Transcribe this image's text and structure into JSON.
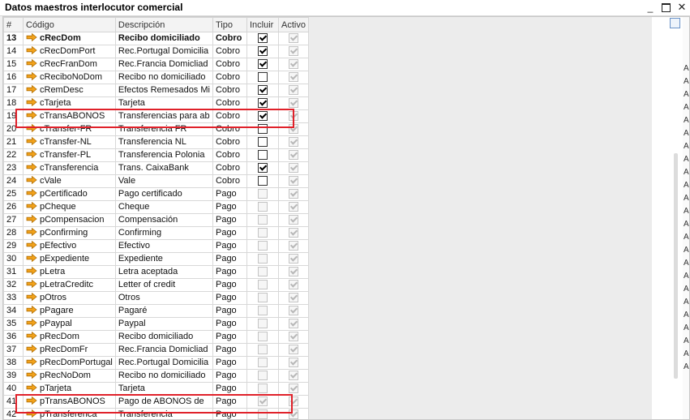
{
  "window": {
    "title": "Datos maestros interlocutor comercial"
  },
  "columns": {
    "num": "#",
    "code": "Código",
    "desc": "Descripción",
    "type": "Tipo",
    "include": "Incluir",
    "active": "Activo"
  },
  "rows": [
    {
      "num": "13",
      "code": "cRecDom",
      "desc": "Recibo domiciliado",
      "type": "Cobro",
      "include": true,
      "include_enabled": true,
      "active": true,
      "bold": true
    },
    {
      "num": "14",
      "code": "cRecDomPort",
      "desc": "Rec.Portugal Domicilia",
      "type": "Cobro",
      "include": true,
      "include_enabled": true,
      "active": true
    },
    {
      "num": "15",
      "code": "cRecFranDom",
      "desc": "Rec.Francia Domicliad",
      "type": "Cobro",
      "include": true,
      "include_enabled": true,
      "active": true
    },
    {
      "num": "16",
      "code": "cReciboNoDom",
      "desc": "Recibo no domiciliado",
      "type": "Cobro",
      "include": false,
      "include_enabled": true,
      "active": true
    },
    {
      "num": "17",
      "code": "cRemDesc",
      "desc": "Efectos Remesados Mi",
      "type": "Cobro",
      "include": true,
      "include_enabled": true,
      "active": true
    },
    {
      "num": "18",
      "code": "cTarjeta",
      "desc": "Tarjeta",
      "type": "Cobro",
      "include": true,
      "include_enabled": true,
      "active": true
    },
    {
      "num": "19",
      "code": "cTransABONOS",
      "desc": "Transferencias para ab",
      "type": "Cobro",
      "include": true,
      "include_enabled": true,
      "active": true
    },
    {
      "num": "20",
      "code": "cTransfer-FR",
      "desc": "Transferencia FR",
      "type": "Cobro",
      "include": false,
      "include_enabled": true,
      "active": true
    },
    {
      "num": "21",
      "code": "cTransfer-NL",
      "desc": "Transferencia NL",
      "type": "Cobro",
      "include": false,
      "include_enabled": true,
      "active": true
    },
    {
      "num": "22",
      "code": "cTransfer-PL",
      "desc": "Transferencia Polonia",
      "type": "Cobro",
      "include": false,
      "include_enabled": true,
      "active": true
    },
    {
      "num": "23",
      "code": "cTransferencia",
      "desc": "Trans. CaixaBank",
      "type": "Cobro",
      "include": true,
      "include_enabled": true,
      "active": true
    },
    {
      "num": "24",
      "code": "cVale",
      "desc": "Vale",
      "type": "Cobro",
      "include": false,
      "include_enabled": true,
      "active": true
    },
    {
      "num": "25",
      "code": "pCertificado",
      "desc": "Pago certificado",
      "type": "Pago",
      "include": false,
      "include_enabled": false,
      "active": true
    },
    {
      "num": "26",
      "code": "pCheque",
      "desc": "Cheque",
      "type": "Pago",
      "include": false,
      "include_enabled": false,
      "active": true
    },
    {
      "num": "27",
      "code": "pCompensacion",
      "desc": "Compensación",
      "type": "Pago",
      "include": false,
      "include_enabled": false,
      "active": true
    },
    {
      "num": "28",
      "code": "pConfirming",
      "desc": "Confirming",
      "type": "Pago",
      "include": false,
      "include_enabled": false,
      "active": true
    },
    {
      "num": "29",
      "code": "pEfectivo",
      "desc": "Efectivo",
      "type": "Pago",
      "include": false,
      "include_enabled": false,
      "active": true
    },
    {
      "num": "30",
      "code": "pExpediente",
      "desc": "Expediente",
      "type": "Pago",
      "include": false,
      "include_enabled": false,
      "active": true
    },
    {
      "num": "31",
      "code": "pLetra",
      "desc": "Letra aceptada",
      "type": "Pago",
      "include": false,
      "include_enabled": false,
      "active": true
    },
    {
      "num": "32",
      "code": "pLetraCreditc",
      "desc": "Letter of credit",
      "type": "Pago",
      "include": false,
      "include_enabled": false,
      "active": true
    },
    {
      "num": "33",
      "code": "pOtros",
      "desc": "Otros",
      "type": "Pago",
      "include": false,
      "include_enabled": false,
      "active": true
    },
    {
      "num": "34",
      "code": "pPagare",
      "desc": "Pagaré",
      "type": "Pago",
      "include": false,
      "include_enabled": false,
      "active": true
    },
    {
      "num": "35",
      "code": "pPaypal",
      "desc": "Paypal",
      "type": "Pago",
      "include": false,
      "include_enabled": false,
      "active": true
    },
    {
      "num": "36",
      "code": "pRecDom",
      "desc": "Recibo domiciliado",
      "type": "Pago",
      "include": false,
      "include_enabled": false,
      "active": true
    },
    {
      "num": "37",
      "code": "pRecDomFr",
      "desc": "Rec.Francia Domicliad",
      "type": "Pago",
      "include": false,
      "include_enabled": false,
      "active": true
    },
    {
      "num": "38",
      "code": "pRecDomPortugal",
      "desc": "Rec.Portugal Domicilia",
      "type": "Pago",
      "include": false,
      "include_enabled": false,
      "active": true
    },
    {
      "num": "39",
      "code": "pRecNoDom",
      "desc": "Recibo no domiciliado",
      "type": "Pago",
      "include": false,
      "include_enabled": false,
      "active": true
    },
    {
      "num": "40",
      "code": "pTarjeta",
      "desc": "Tarjeta",
      "type": "Pago",
      "include": false,
      "include_enabled": false,
      "active": true
    },
    {
      "num": "41",
      "code": "pTransABONOS",
      "desc": "Pago de ABONOS de",
      "type": "Pago",
      "include": true,
      "include_enabled": false,
      "active": true
    },
    {
      "num": "42",
      "code": "pTransferenca",
      "desc": "Transferencia",
      "type": "Pago",
      "include": false,
      "include_enabled": false,
      "active": true
    }
  ],
  "side_letters": [
    "A",
    "A",
    "A",
    "A",
    "A",
    "A",
    "A",
    "A",
    "A",
    "A",
    "A",
    "A",
    "A",
    "A",
    "A",
    "A",
    "A",
    "A",
    "A",
    "A",
    "A",
    "A",
    "A",
    "A"
  ],
  "colors": {
    "highlight": "#e0212a",
    "arrow": "#f2a21b"
  }
}
